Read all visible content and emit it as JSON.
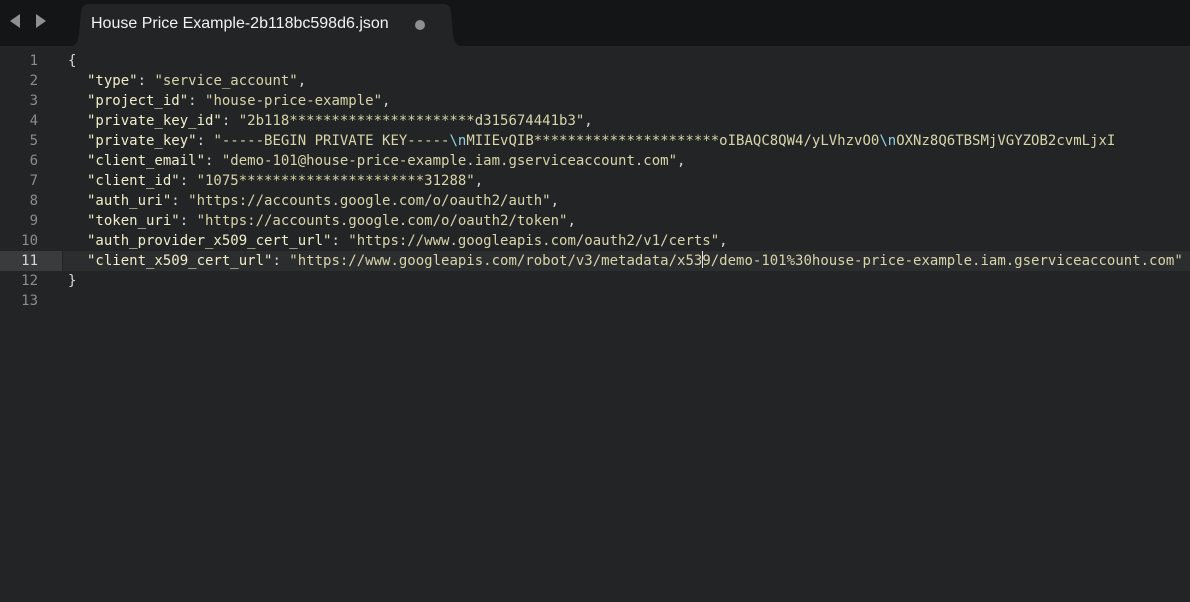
{
  "tab": {
    "title": "House Price Example-2b118bc598d6.json"
  },
  "editor": {
    "line_numbers": [
      "1",
      "2",
      "3",
      "4",
      "5",
      "6",
      "7",
      "8",
      "9",
      "10",
      "11",
      "12",
      "13"
    ],
    "current_line": 11,
    "open_brace": "{",
    "close_brace": "}",
    "entries": [
      {
        "key": "\"type\"",
        "value": "\"service_account\"",
        "sep": ": ",
        "tail": ","
      },
      {
        "key": "\"project_id\"",
        "value": "\"house-price-example\"",
        "sep": ": ",
        "tail": ","
      },
      {
        "key": "\"private_key_id\"",
        "value": "\"2b118**********************d315674441b3\"",
        "sep": ": ",
        "tail": ","
      },
      {
        "key": "\"private_key\"",
        "value_start": "\"-----BEGIN PRIVATE KEY-----",
        "escape1": "\\n",
        "value_mid": "MIIEvQIB**********************oIBAQC8QW4/yLVhzvO0",
        "escape2": "\\n",
        "value_end": "OXNz8Q6TBSMjVGYZOB2cvmLjxI",
        "sep": ": "
      },
      {
        "key": "\"client_email\"",
        "value": "\"demo-101@house-price-example.iam.gserviceaccount.com\"",
        "sep": ": ",
        "tail": ","
      },
      {
        "key": "\"client_id\"",
        "value": "\"1075**********************31288\"",
        "sep": ": ",
        "tail": ","
      },
      {
        "key": "\"auth_uri\"",
        "value": "\"https://accounts.google.com/o/oauth2/auth\"",
        "sep": ": ",
        "tail": ","
      },
      {
        "key": "\"token_uri\"",
        "value": "\"https://accounts.google.com/o/oauth2/token\"",
        "sep": ": ",
        "tail": ","
      },
      {
        "key": "\"auth_provider_x509_cert_url\"",
        "value": "\"https://www.googleapis.com/oauth2/v1/certs\"",
        "sep": ": ",
        "tail": ","
      },
      {
        "key": "\"client_x509_cert_url\"",
        "value_before_caret": "\"https://www.googleapis.com/robot/v3/metadata/x53",
        "value_after_caret": "9/demo-101%30house-price-example.iam.gserviceaccount.com\"",
        "sep": ": "
      }
    ]
  }
}
